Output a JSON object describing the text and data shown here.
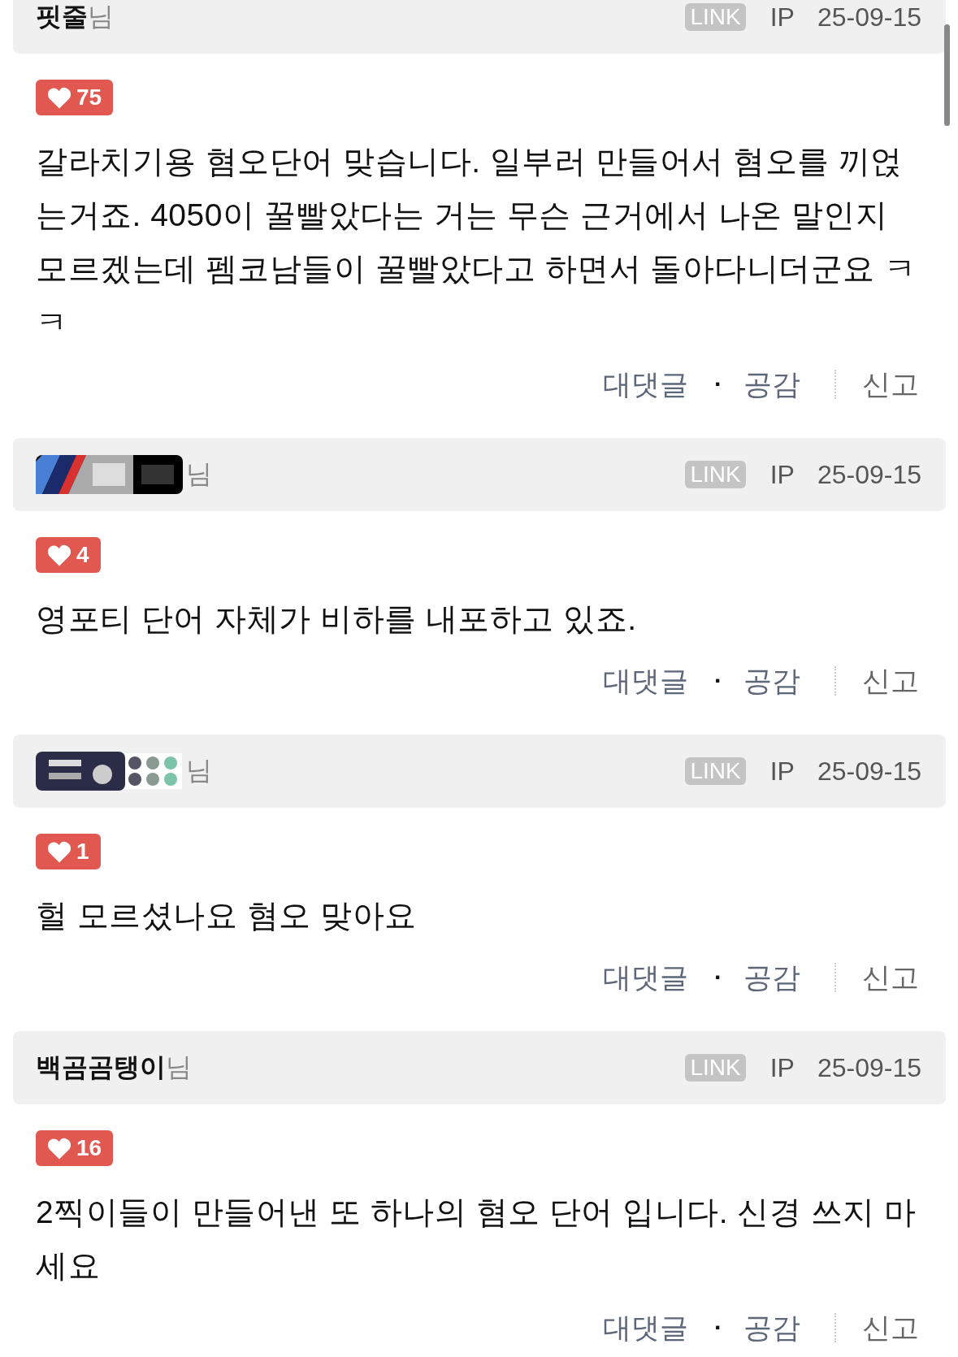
{
  "comments": [
    {
      "author": {
        "kind": "text",
        "name": "핏줄"
      },
      "honorific": "님",
      "link": "LINK",
      "ip": "IP",
      "date": "25-09-15",
      "likes": "75",
      "body": "갈라치기용 혐오단어 맞습니다. 일부러 만들어서 혐오를 끼얹는거죠. 4050이 꿀빨았다는 거는 무슨 근거에서 나온 말인지 모르겠는데 펨코남들이 꿀빨았다고 하면서 돌아다니더군요 ㅋㅋ",
      "actions": {
        "reply": "대댓글",
        "dot": "·",
        "like": "공감",
        "report": "신고"
      }
    },
    {
      "honorific": "님",
      "link": "LINK",
      "ip": "IP",
      "date": "25-09-15",
      "likes": "4",
      "body": "영포티 단어 자체가 비하를 내포하고 있죠.",
      "actions": {
        "reply": "대댓글",
        "dot": "·",
        "like": "공감",
        "report": "신고"
      }
    },
    {
      "honorific": "님",
      "link": "LINK",
      "ip": "IP",
      "date": "25-09-15",
      "likes": "1",
      "body": "헐 모르셨나요 혐오 맞아요",
      "actions": {
        "reply": "대댓글",
        "dot": "·",
        "like": "공감",
        "report": "신고"
      }
    },
    {
      "author": {
        "kind": "text",
        "name": "백곰곰탱이"
      },
      "honorific": "님",
      "link": "LINK",
      "ip": "IP",
      "date": "25-09-15",
      "likes": "16",
      "body": "2찍이들이 만들어낸 또 하나의 혐오 단어 입니다. 신경 쓰지 마세요",
      "actions": {
        "reply": "대댓글",
        "dot": "·",
        "like": "공감",
        "report": "신고"
      }
    }
  ]
}
